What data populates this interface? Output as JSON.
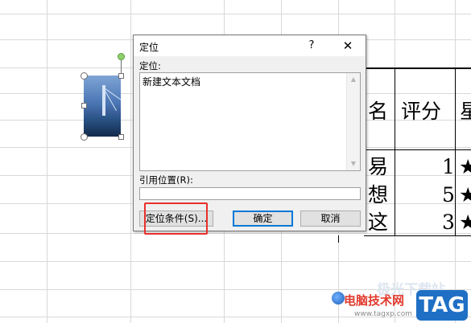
{
  "dialog": {
    "title": "定位",
    "help_label": "?",
    "close_label": "✕",
    "list_label": "定位:",
    "list_items": [
      "新建文本文档"
    ],
    "scroll_up": "▲",
    "scroll_down": "▼",
    "reference_label": "引用位置(R):",
    "reference_value": "",
    "buttons": {
      "special": "定位条件(S)...",
      "ok": "确定",
      "cancel": "取消"
    }
  },
  "sheet": {
    "header_fragment_1": "名",
    "header_fragment_2": "评分",
    "header_fragment_3": "星",
    "rows": [
      {
        "name": "易",
        "score": "1",
        "star": "★"
      },
      {
        "name": "想",
        "score": "5",
        "star": "★"
      },
      {
        "name": "这",
        "score": "3",
        "star": "★"
      }
    ]
  },
  "watermark": {
    "site_name": "电脑技术网",
    "url": "www.tagxp.com",
    "ghost_text": "极光下载站",
    "tag": "TAG"
  },
  "colors": {
    "highlight": "#e8302c",
    "watermark_red": "#e23b2e",
    "watermark_blue": "#1f6fc5"
  }
}
